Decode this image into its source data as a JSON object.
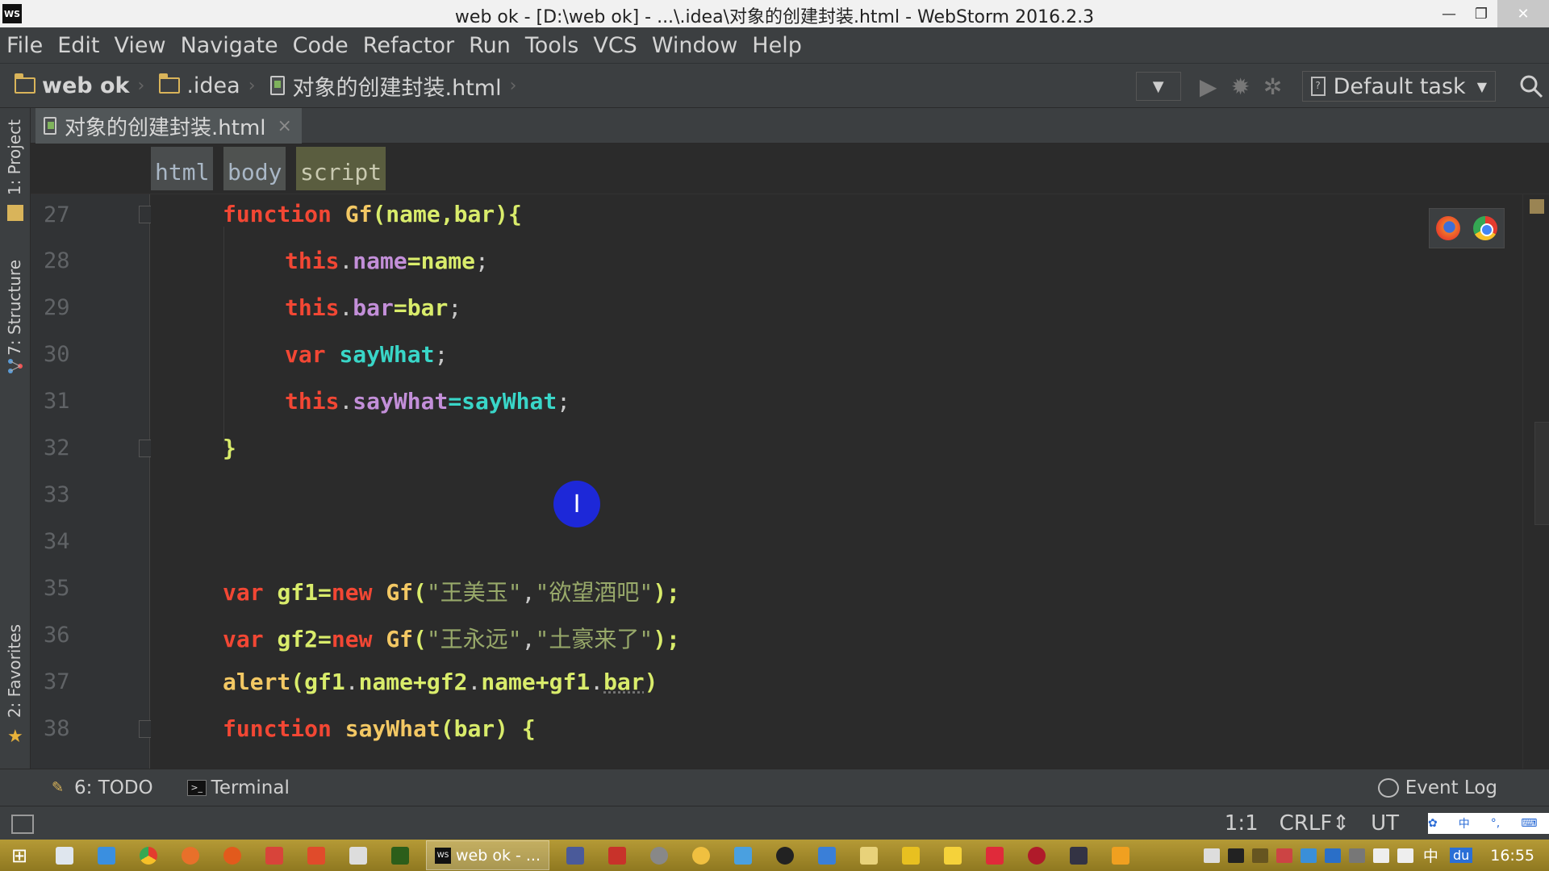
{
  "window": {
    "title": "web ok - [D:\\web ok] - ...\\.idea\\对象的创建封装.html - WebStorm 2016.2.3",
    "logo": "WS",
    "controls": {
      "minimize": "—",
      "restore": "❐",
      "close": "✕"
    }
  },
  "menu": [
    "File",
    "Edit",
    "View",
    "Navigate",
    "Code",
    "Refactor",
    "Run",
    "Tools",
    "VCS",
    "Window",
    "Help"
  ],
  "breadcrumb": {
    "project": "web ok",
    "folder": ".idea",
    "file": "对象的创建封装.html"
  },
  "toolbar": {
    "run_config": "Default task"
  },
  "editor_tab": {
    "label": "对象的创建封装.html",
    "close": "×"
  },
  "tags": [
    "html",
    "body",
    "script"
  ],
  "side_tabs": {
    "project": "1: Project",
    "structure": "7: Structure",
    "favorites": "2: Favorites"
  },
  "line_numbers": [
    "27",
    "28",
    "29",
    "30",
    "31",
    "32",
    "33",
    "34",
    "35",
    "36",
    "37",
    "38"
  ],
  "code": {
    "l27": {
      "kw": "function",
      "name": "Gf",
      "rest": "(name,bar){"
    },
    "l28": {
      "kw": "this",
      "dot": ".",
      "prop": "name",
      "rest": "=name",
      "semi": ";"
    },
    "l29": {
      "kw": "this",
      "dot": ".",
      "prop": "bar",
      "rest": "=bar",
      "semi": ";"
    },
    "l30": {
      "kw": "var",
      "name": "sayWhat",
      "semi": ";"
    },
    "l31": {
      "kw": "this",
      "dot": ".",
      "prop": "sayWhat",
      "rest": "=sayWhat",
      "semi": ";"
    },
    "l32": {
      "brace": "}"
    },
    "l35": {
      "kw": "var",
      "id": "gf1",
      "op": "=",
      "kw2": "new",
      "fn": "Gf",
      "p1": "(",
      "s1": "\"王美玉\"",
      "comma": ",",
      "s2": "\"欲望酒吧\"",
      "p2": ");"
    },
    "l36": {
      "kw": "var",
      "id": "gf2",
      "op": "=",
      "kw2": "new",
      "fn": "Gf",
      "p1": "(",
      "s1": "\"王永远\"",
      "comma": ",",
      "s2": "\"土豪来了\"",
      "p2": ");"
    },
    "l37": {
      "fn": "alert",
      "p1": "(",
      "a": "gf1",
      "d1": ".",
      "b": "name",
      "plus1": "+",
      "c": "gf2",
      "d2": ".",
      "e": "name",
      "plus2": "+",
      "f": "gf1",
      "d3": ".",
      "g": "bar",
      "p2": ")"
    },
    "l38": {
      "kw": "function",
      "name": "sayWhat",
      "rest": "(bar) {"
    }
  },
  "cursor_glyph": "I",
  "tool_windows": {
    "todo": "6: TODO",
    "terminal": "Terminal",
    "event_log": "Event Log"
  },
  "status": {
    "position": "1:1",
    "line_sep": "CRLF⇕",
    "encoding": "UT"
  },
  "taskbar": {
    "active_app": "web ok - ...",
    "clock": "16:55",
    "ime_char": "中",
    "baidu": "du"
  }
}
